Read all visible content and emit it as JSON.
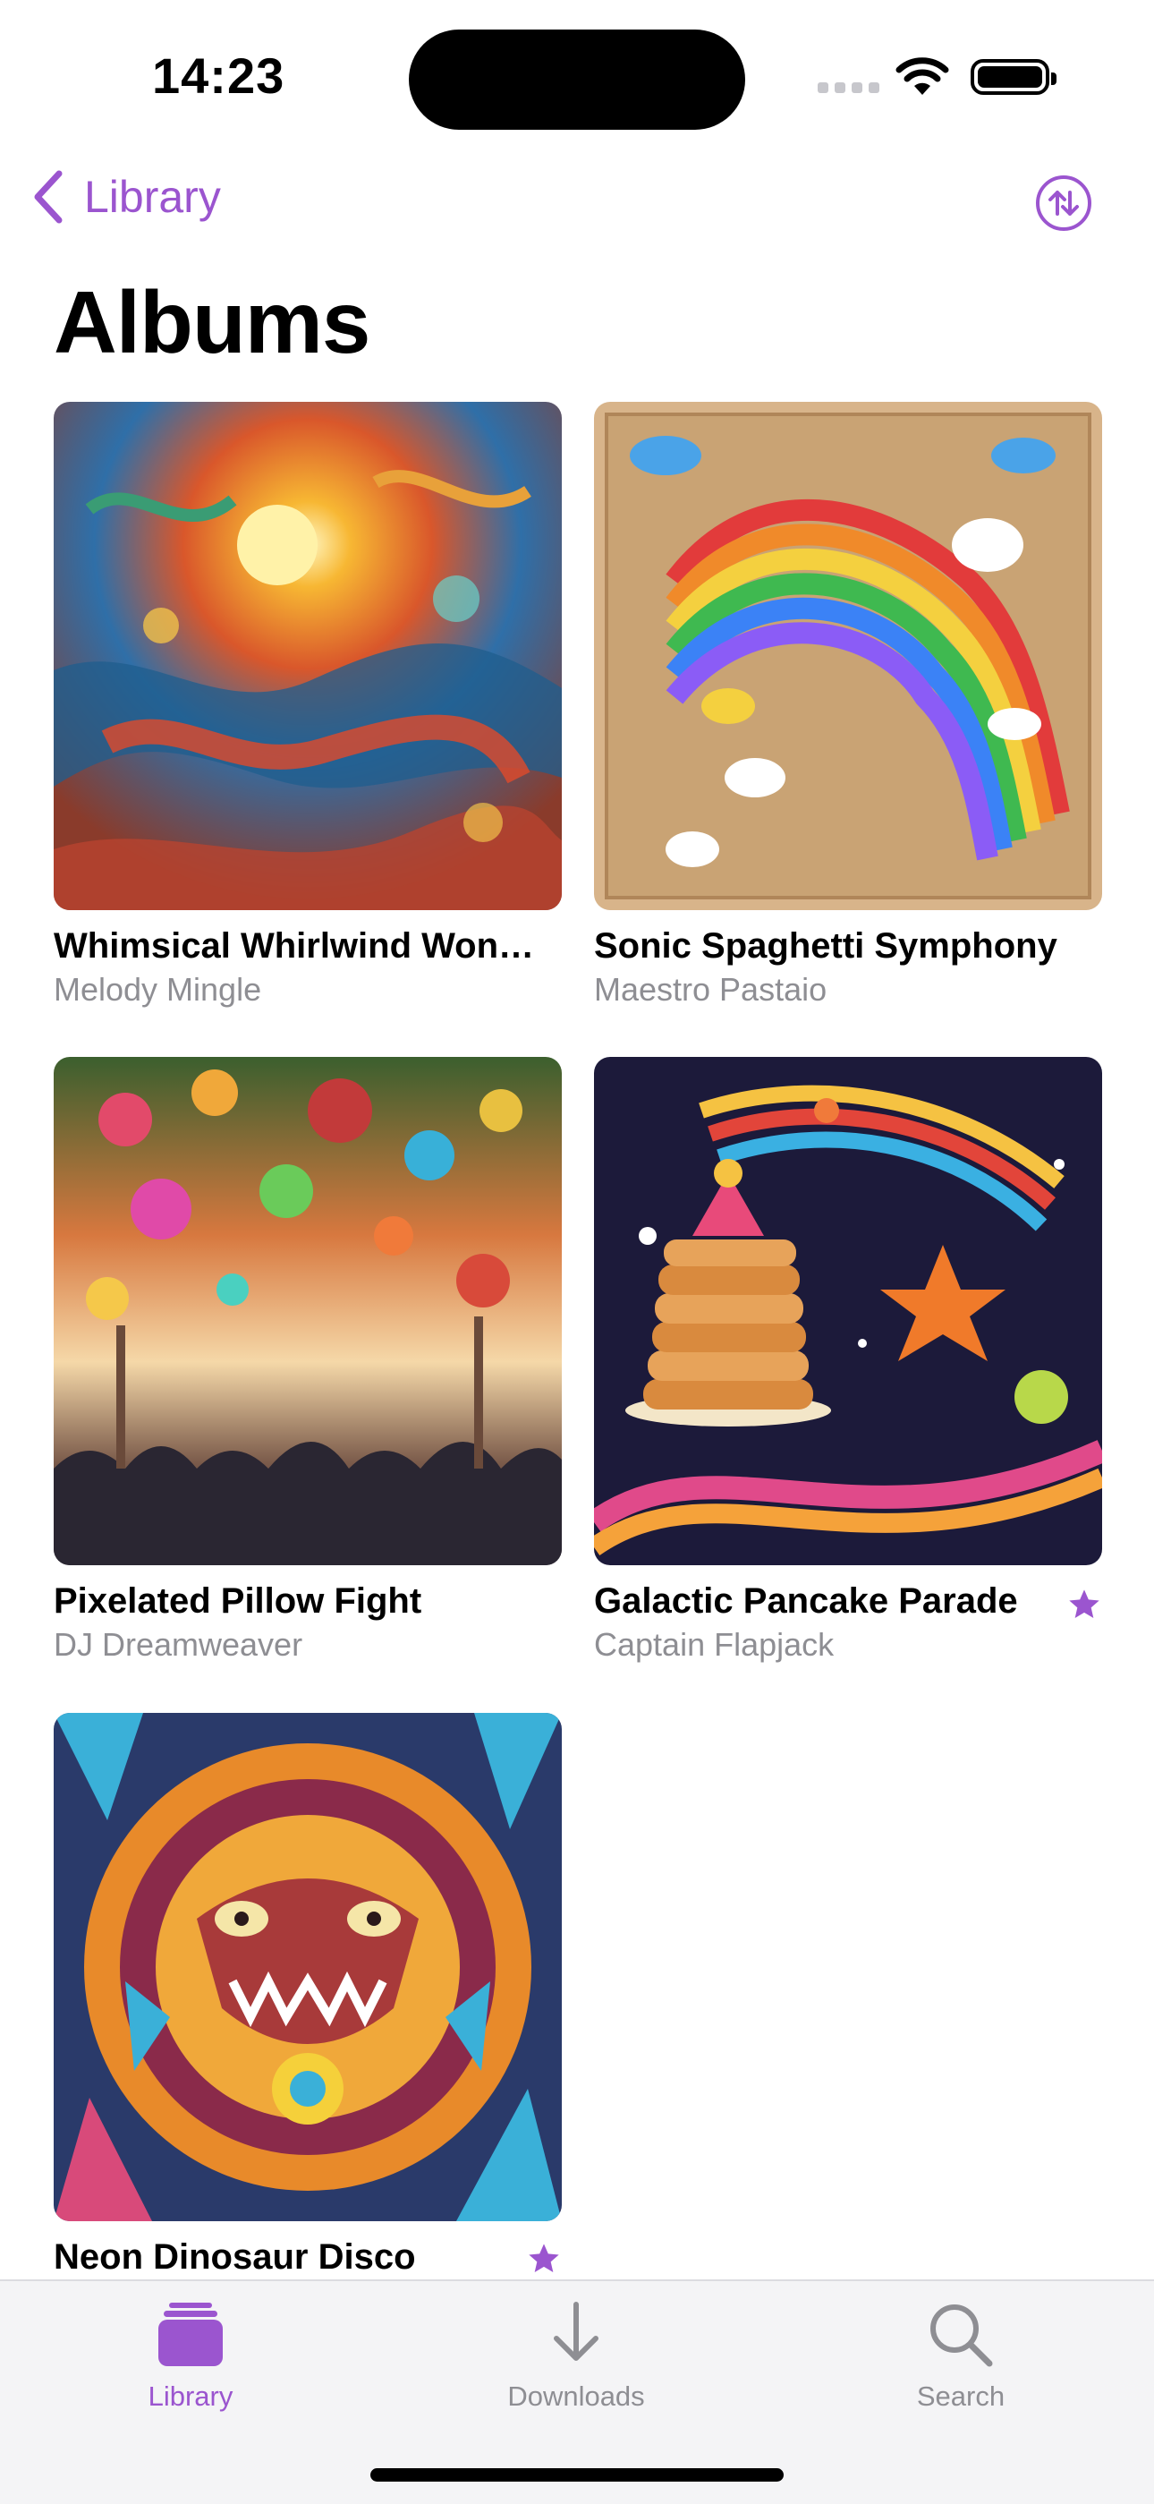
{
  "status_bar": {
    "time": "14:23"
  },
  "nav": {
    "back_label": "Library",
    "title": "Albums"
  },
  "albums": [
    {
      "title": "Whimsical Whirlwind Wond…",
      "artist": "Melody Mingle",
      "favorite": false,
      "cover": "Psychedelic swirling sea-and-sun artwork"
    },
    {
      "title": "Sonic Spaghetti Symphony",
      "artist": "Maestro Pastaio",
      "favorite": false,
      "cover": "Rainbow ribbon and cartoon figures on wooden puzzle"
    },
    {
      "title": "Pixelated Pillow Fight",
      "artist": "DJ Dreamweaver",
      "favorite": false,
      "cover": "Colorful balloon festival over a crowd"
    },
    {
      "title": "Galactic Pancake Parade",
      "artist": "Captain Flapjack",
      "favorite": true,
      "cover": "Stack of pancakes floating in rainbow space"
    },
    {
      "title": "Neon Dinosaur Disco",
      "artist": "",
      "favorite": true,
      "cover": "Mosaic dinosaur face in vivid colors"
    }
  ],
  "tabs": [
    {
      "label": "Library",
      "icon": "stack-icon",
      "active": true
    },
    {
      "label": "Downloads",
      "icon": "download-arrow-icon",
      "active": false
    },
    {
      "label": "Search",
      "icon": "magnifier-icon",
      "active": false
    }
  ],
  "colors": {
    "accent": "#9b55cf",
    "secondary_text": "#8e8e93",
    "tabbar_bg": "#f4f4f6"
  }
}
